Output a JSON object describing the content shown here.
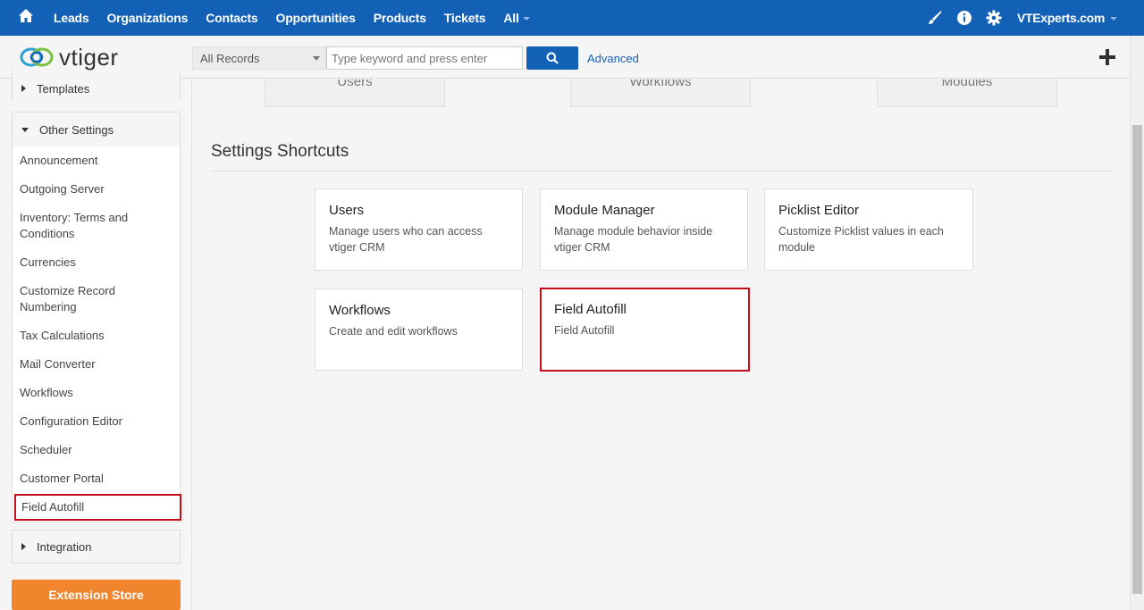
{
  "topnav": {
    "items": [
      "Leads",
      "Organizations",
      "Contacts",
      "Opportunities",
      "Products",
      "Tickets",
      "All"
    ],
    "user": "VTExperts.com",
    "icons": [
      "home-icon",
      "brush-icon",
      "info-icon",
      "gear-icon"
    ]
  },
  "header": {
    "logo_text": "vtiger",
    "record_select": "All Records",
    "search_placeholder": "Type keyword and press enter",
    "advanced_label": "Advanced"
  },
  "sidebar": {
    "templates_label": "Templates",
    "other_settings_label": "Other Settings",
    "items": [
      "Announcement",
      "Outgoing Server",
      "Inventory: Terms and Conditions",
      "Currencies",
      "Customize Record Numbering",
      "Tax Calculations",
      "Mail Converter",
      "Workflows",
      "Configuration Editor",
      "Scheduler",
      "Customer Portal",
      "Field Autofill"
    ],
    "integration_label": "Integration",
    "extension_store_label": "Extension Store"
  },
  "main": {
    "top_cards": [
      "Users",
      "Workflows",
      "Modules"
    ],
    "section_title": "Settings Shortcuts",
    "shortcuts": [
      {
        "title": "Users",
        "desc": "Manage users who can access vtiger CRM"
      },
      {
        "title": "Module Manager",
        "desc": "Manage module behavior inside vtiger CRM"
      },
      {
        "title": "Picklist Editor",
        "desc": "Customize Picklist values in each module"
      },
      {
        "title": "Workflows",
        "desc": "Create and edit workflows"
      },
      {
        "title": "Field Autofill",
        "desc": "Field Autofill"
      }
    ]
  },
  "colors": {
    "nav_blue": "#1360b7",
    "highlight_red": "#c40f1a",
    "extension_orange": "#f0852e"
  }
}
